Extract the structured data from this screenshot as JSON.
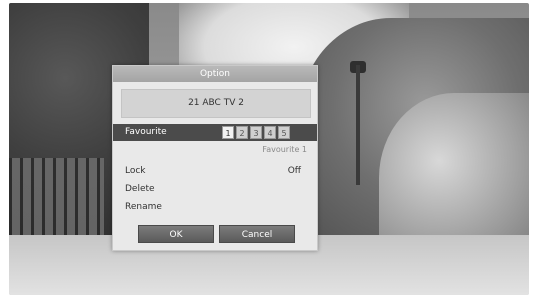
{
  "dialog": {
    "title": "Option",
    "channel": "21 ABC TV 2",
    "favourite": {
      "label": "Favourite",
      "numbers": [
        "1",
        "2",
        "3",
        "4",
        "5"
      ],
      "selected_sub": "Favourite 1"
    },
    "options": [
      {
        "label": "Lock",
        "value": "Off"
      },
      {
        "label": "Delete",
        "value": ""
      },
      {
        "label": "Rename",
        "value": ""
      }
    ],
    "buttons": {
      "ok": "OK",
      "cancel": "Cancel"
    }
  },
  "colors": {
    "highlight_row": "#4b4b4b",
    "dialog_bg": "#e9e9e9",
    "button_bg": "#6a6a6a"
  }
}
